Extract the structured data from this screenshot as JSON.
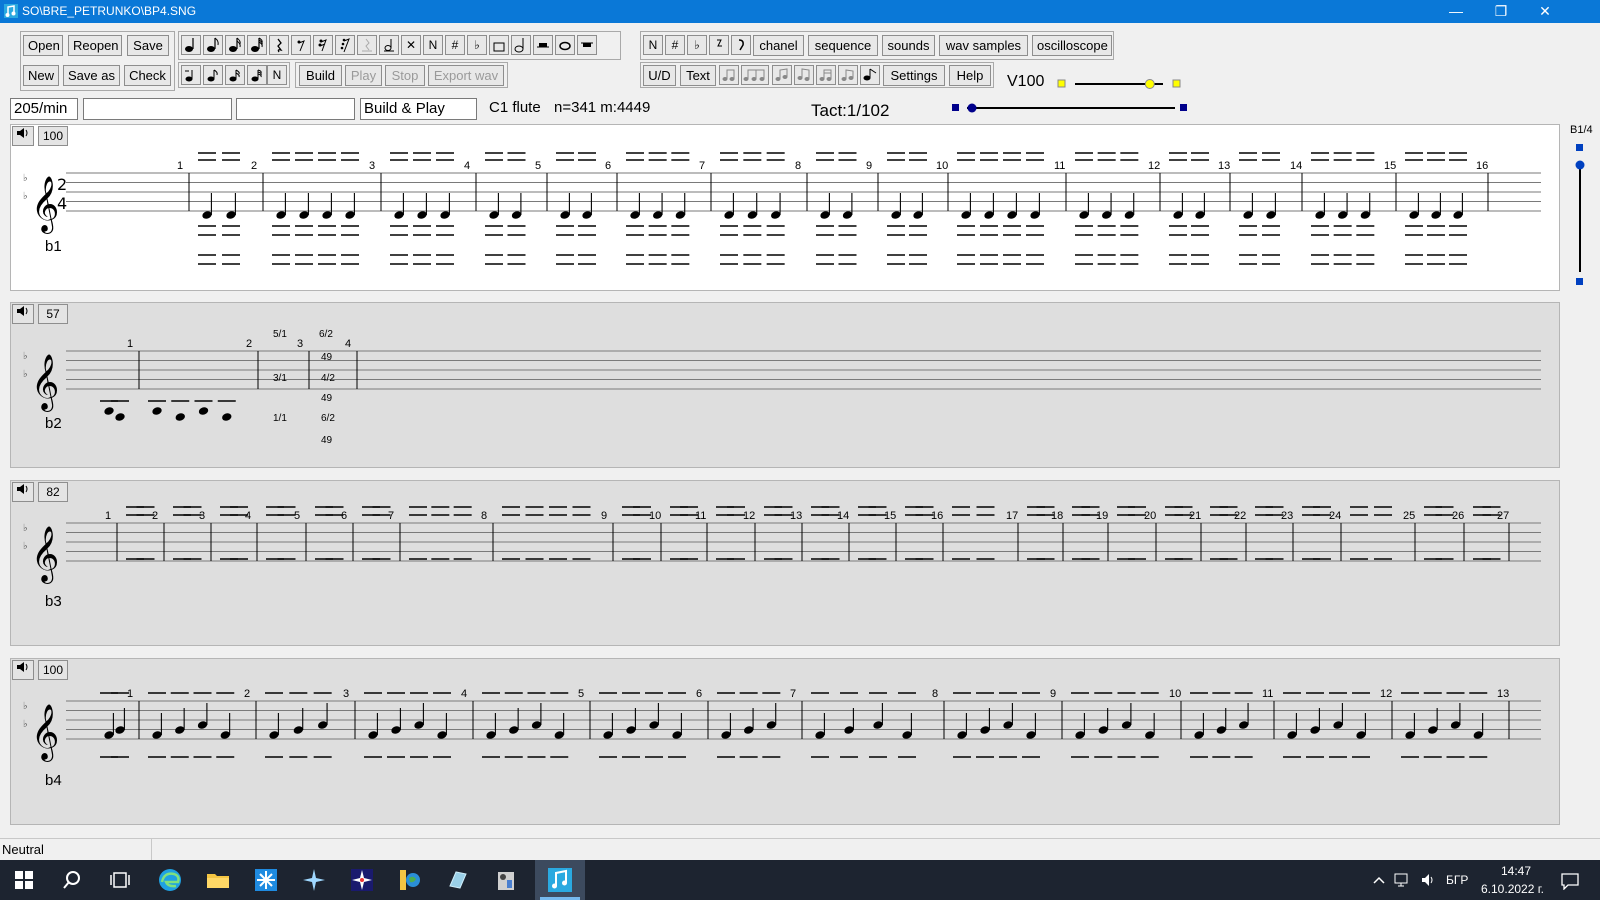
{
  "window": {
    "title": "SO\\BRE_PETRUNKO\\BP4.SNG",
    "minimize": "—",
    "maximize": "❐",
    "close": "✕"
  },
  "file_buttons": {
    "open": "Open",
    "reopen": "Reopen",
    "save": "Save",
    "new": "New",
    "save_as": "Save as",
    "check": "Check"
  },
  "note_tools": {
    "n": "N",
    "sharp": "#",
    "flat": "♭",
    "cross": "✕"
  },
  "build_buttons": {
    "build": "Build",
    "play": "Play",
    "stop": "Stop",
    "export_wav": "Export wav"
  },
  "right_toolbar": {
    "n": "N",
    "sharp": "#",
    "flat": "♭",
    "chanel": "chanel",
    "sequence": "sequence",
    "sounds": "sounds",
    "wav_samples": "wav samples",
    "oscilloscope": "oscilloscope",
    "ud": "U/D",
    "text": "Text",
    "settings": "Settings",
    "help": "Help"
  },
  "volume": {
    "label": "V100",
    "level": 0.85
  },
  "tact_slider": {
    "level": 0.0
  },
  "fields": {
    "tempo": "205/min",
    "field2": "",
    "field3": "",
    "build_play": "Build & Play"
  },
  "info": {
    "instrument": "C1 flute",
    "stats": "n=341 m:4449",
    "tact": "Tact:1/102"
  },
  "side_label": "B1/4",
  "tracks": [
    {
      "name": "b1",
      "volume": "100",
      "time_sig": [
        "2",
        "4"
      ],
      "measures": [
        "1",
        "2",
        "3",
        "4",
        "5",
        "6",
        "7",
        "8",
        "9",
        "10",
        "11",
        "12",
        "13",
        "14",
        "15",
        "16"
      ]
    },
    {
      "name": "b2",
      "volume": "57",
      "measures": [
        "1",
        "2",
        "3",
        "4"
      ],
      "labels": [
        "5/1",
        "6/2",
        "49",
        "3/1",
        "4/2",
        "49",
        "1/1",
        "6/2",
        "49"
      ]
    },
    {
      "name": "b3",
      "volume": "82",
      "measures": [
        "1",
        "2",
        "3",
        "4",
        "5",
        "6",
        "7",
        "8",
        "9",
        "10",
        "11",
        "12",
        "13",
        "14",
        "15",
        "16",
        "17",
        "18",
        "19",
        "20",
        "21",
        "22",
        "23",
        "24",
        "25",
        "26",
        "27"
      ]
    },
    {
      "name": "b4",
      "volume": "100",
      "measures": [
        "1",
        "2",
        "3",
        "4",
        "5",
        "6",
        "7",
        "8",
        "9",
        "10",
        "11",
        "12",
        "13"
      ]
    }
  ],
  "status": {
    "text": "Neutral"
  },
  "taskbar": {
    "lang": "БГР",
    "time": "14:47",
    "date": "6.10.2022 г."
  }
}
